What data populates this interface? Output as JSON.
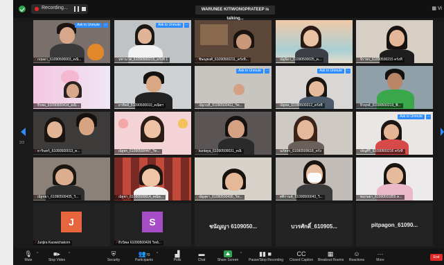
{
  "app": {
    "title": "Zoom Meeting"
  },
  "topbar": {
    "recording_label": "Recording...",
    "talking_banner": "WARUNEE KITIWONGPRATEEP is talking...",
    "view_label": "Vi"
  },
  "pagination": {
    "page": "2/3"
  },
  "tiles": [
    {
      "name": "กฤษดา_61090500003_คณิ...",
      "unmute": "Ask to Unmute",
      "muted": true
    },
    {
      "name": "จุฑามาศ_61090500215_ครั้งที่ 1",
      "unmute": "Ask to Unmute",
      "muted": true
    },
    {
      "name": "ชิษณุพงศ์_61090500211_ครั้งที่...",
      "muted": true
    },
    {
      "name": "ณัฐธิดา_61090500025_ค...",
      "muted": true
    },
    {
      "name": "จิราพร_61090500215 ครั้งที่",
      "muted": true
    },
    {
      "name": "ธีรพล_61090500414_คณิ...",
      "muted": true
    },
    {
      "name": "อาทิตย์_61090500010_คณิตฯ",
      "muted": true
    },
    {
      "name": "ณัฐกฤติ_61090500411_วิท...",
      "unmute": "Ask to Unmute",
      "muted": true
    },
    {
      "name": "ณัฐพล_61090500212_ครั้งที่",
      "unmute": "Ask to Unmute",
      "muted": true
    },
    {
      "name": "ธีรยุทธ์_61090500219_ฟิ...",
      "muted": true
    },
    {
      "name": "ธารินทร์_61090500013_ค...",
      "muted": true
    },
    {
      "name": "ณัฐพร_61090500447_วิท...",
      "muted": true
    },
    {
      "name": "kuntaya_61090500031_คณิ",
      "muted": true
    },
    {
      "name": "นภัสสร_61090500618_ครั้ง",
      "muted": true
    },
    {
      "name": "เพ็ญศิริ_61090500216 ครั้งที่",
      "unmute": "Ask to Unmute",
      "muted": true
    },
    {
      "name": "ณัฐชยา_61090500435_วิ...",
      "muted": true
    },
    {
      "name": "ณัฐชา_61090500014_คณิต...",
      "muted": true
    },
    {
      "name": "ณัฐสุดา_61090500436_วิท...",
      "muted": true
    },
    {
      "name": "ศศิกานต์_61090500043_วิ...",
      "muted": true
    },
    {
      "name": "พฤกษยา_61090501855 ค...",
      "muted": true
    },
    {
      "name": "Junjira Kaowichakorn",
      "avatar": "J",
      "avatar_color": "#e8663d",
      "muted": true
    },
    {
      "name": "ธีรนิพล 61090500426 วิทย์...",
      "avatar": "S",
      "avatar_color": "#a64cc7",
      "muted": true
    },
    {
      "display": "ชนัญญา 6109050...",
      "name": "ชนัญญา 6109050...",
      "muted": true
    },
    {
      "display": "บวรศักดิ์_610905...",
      "name": "บวรศักดิ์_610905...",
      "muted": true
    },
    {
      "display": "pitpagon_61090...",
      "name": "pitpagon_61090...",
      "muted": true
    }
  ],
  "toolbar": {
    "mute": "Mute",
    "stop_video": "Stop Video",
    "security": "Security",
    "participants": "Participants",
    "participants_count": "70",
    "polls": "Polls",
    "chat": "Chat",
    "share_screen": "Share Screen",
    "pause_recording": "Pause/Stop Recording",
    "closed_caption": "Closed Caption",
    "breakout_rooms": "Breakout Rooms",
    "reactions": "Reactions",
    "more": "More",
    "end": "End"
  },
  "colors": {
    "accent": "#2d8cff",
    "recording": "#e02828",
    "share": "#2ea44f"
  }
}
